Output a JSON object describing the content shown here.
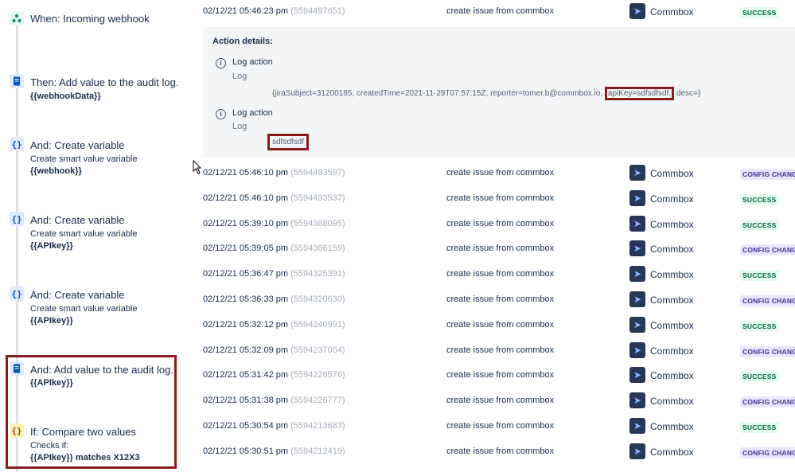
{
  "rule_steps": [
    {
      "icon": "webhook-icon",
      "title": "When: Incoming webhook"
    },
    {
      "icon": "audit-log-icon",
      "title": "Then: Add value to the audit log.",
      "value": "{{webhookData}}"
    },
    {
      "icon": "variable-icon",
      "title": "And: Create variable",
      "subtitle": "Create smart value variable",
      "value": "{{webhook}}"
    },
    {
      "icon": "variable-icon",
      "title": "And: Create variable",
      "subtitle": "Create smart value variable",
      "value": "{{APIkey}}"
    },
    {
      "icon": "variable-icon",
      "title": "And: Create variable",
      "subtitle": "Create smart value variable",
      "value": "{{APIkey}}"
    },
    {
      "icon": "audit-log-icon",
      "title": "And: Add value to the audit log.",
      "value": "{{APIkey}}"
    },
    {
      "icon": "condition-icon",
      "title": "If: Compare two values",
      "subtitle": "Checks if:",
      "value": "{{APIkey}} matches X12X3"
    }
  ],
  "first_row": {
    "date": "02/12/21 05:46:23 pm",
    "id": "(5594497651)",
    "summary": "create issue from commbox",
    "project": "Commbox",
    "status": "SUCCESS"
  },
  "action_details": {
    "header": "Action details:",
    "actions": [
      {
        "title": "Log action",
        "subtitle": "Log",
        "body_pre": "{jiraSubject=31200185, createdTime=2021-11-29T07:57:15Z, reporter=tomer.b@commbox.io,",
        "body_highlight": "apiKey=sdfsdfsdf,",
        "body_post": "desc=}"
      },
      {
        "title": "Log action",
        "subtitle": "Log",
        "body_highlight": "sdfsdfsdf"
      }
    ]
  },
  "rows": [
    {
      "date": "02/12/21 05:46:10 pm",
      "id": "(5594493597)",
      "summary": "create issue from commbox",
      "project": "Commbox",
      "status": "CONFIG CHANG",
      "status_type": "config"
    },
    {
      "date": "02/12/21 05:46:10 pm",
      "id": "(5594493537)",
      "summary": "create issue from commbox",
      "project": "Commbox",
      "status": "SUCCESS",
      "status_type": "success"
    },
    {
      "date": "02/12/21 05:39:10 pm",
      "id": "(5594368095)",
      "summary": "create issue from commbox",
      "project": "Commbox",
      "status": "SUCCESS",
      "status_type": "success"
    },
    {
      "date": "02/12/21 05:39:05 pm",
      "id": "(5594366159)",
      "summary": "create issue from commbox",
      "project": "Commbox",
      "status": "CONFIG CHANG",
      "status_type": "config"
    },
    {
      "date": "02/12/21 05:36:47 pm",
      "id": "(5594325391)",
      "summary": "create issue from commbox",
      "project": "Commbox",
      "status": "SUCCESS",
      "status_type": "success"
    },
    {
      "date": "02/12/21 05:36:33 pm",
      "id": "(5594320630)",
      "summary": "create issue from commbox",
      "project": "Commbox",
      "status": "CONFIG CHANG",
      "status_type": "config"
    },
    {
      "date": "02/12/21 05:32:12 pm",
      "id": "(5594240991)",
      "summary": "create issue from commbox",
      "project": "Commbox",
      "status": "SUCCESS",
      "status_type": "success"
    },
    {
      "date": "02/12/21 05:32:09 pm",
      "id": "(5594237054)",
      "summary": "create issue from commbox",
      "project": "Commbox",
      "status": "CONFIG CHANG",
      "status_type": "config"
    },
    {
      "date": "02/12/21 05:31:42 pm",
      "id": "(5594228576)",
      "summary": "create issue from commbox",
      "project": "Commbox",
      "status": "SUCCESS",
      "status_type": "success"
    },
    {
      "date": "02/12/21 05:31:38 pm",
      "id": "(5594226777)",
      "summary": "create issue from commbox",
      "project": "Commbox",
      "status": "CONFIG CHANG",
      "status_type": "config"
    },
    {
      "date": "02/12/21 05:30:54 pm",
      "id": "(5594213683)",
      "summary": "create issue from commbox",
      "project": "Commbox",
      "status": "SUCCESS",
      "status_type": "success"
    },
    {
      "date": "02/12/21 05:30:51 pm",
      "id": "(5594212419)",
      "summary": "create issue from commbox",
      "project": "Commbox",
      "status": "CONFIG CHANG",
      "status_type": "config"
    }
  ]
}
